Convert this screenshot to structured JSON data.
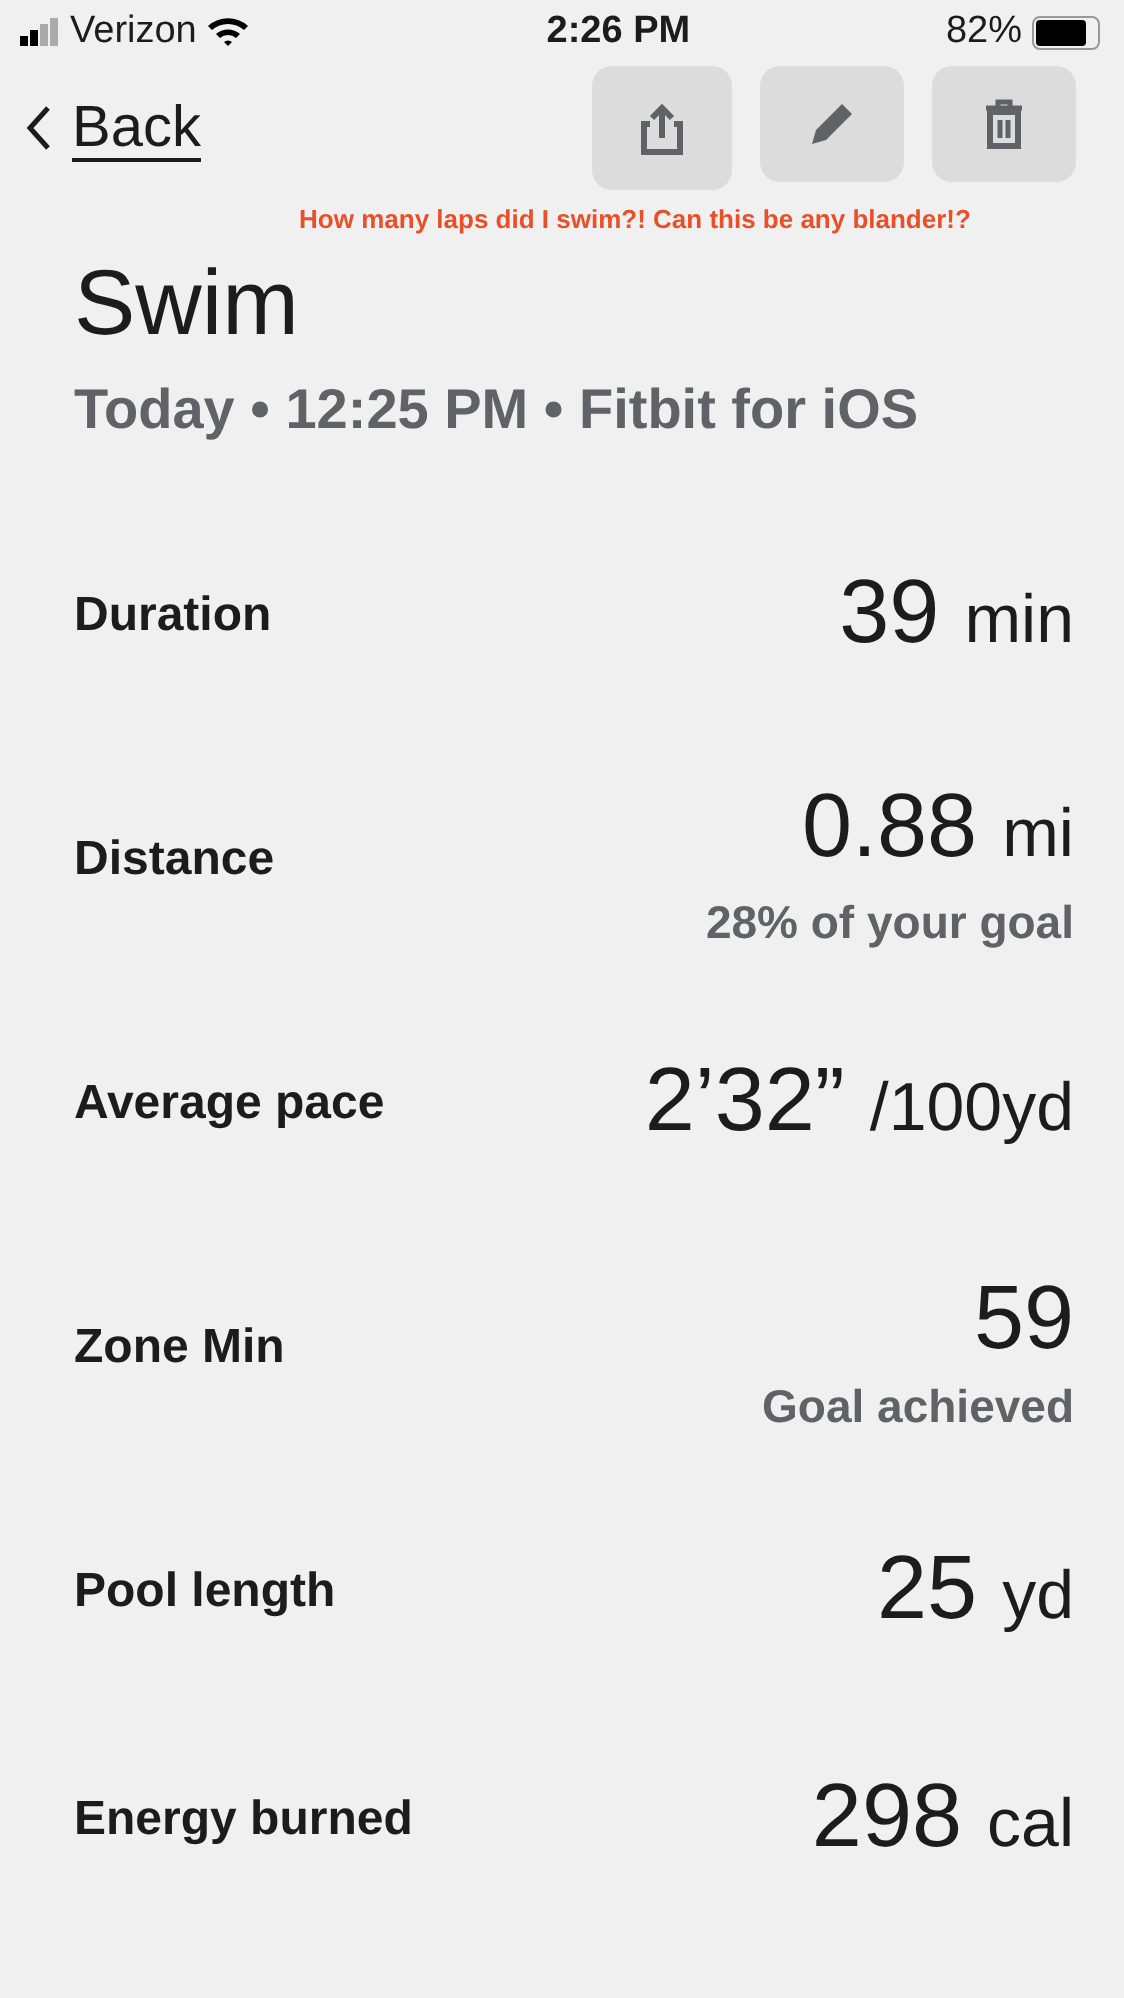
{
  "status_bar": {
    "carrier": "Verizon",
    "time": "2:26 PM",
    "battery": "82%"
  },
  "nav": {
    "back": "Back",
    "actions": [
      {
        "kind": "share"
      },
      {
        "kind": "edit"
      },
      {
        "kind": "delete"
      }
    ]
  },
  "annotation": "How many laps did I swim?! Can this be any blander!?",
  "title": "Swim",
  "subtitle": "Today • 12:25 PM • Fitbit for iOS",
  "stats": [
    {
      "label": "Duration",
      "value": "39",
      "unit": "min"
    },
    {
      "label": "Distance",
      "value": "0.88",
      "unit": "mi",
      "note": "28% of your goal"
    },
    {
      "label": "Average pace",
      "value": "2’32”",
      "unit": "/100yd"
    },
    {
      "label": "Zone Min",
      "value": "59",
      "note": "Goal achieved"
    },
    {
      "label": "Pool length",
      "value": "25",
      "unit": "yd"
    },
    {
      "label": "Energy burned",
      "value": "298",
      "unit": "cal"
    }
  ]
}
